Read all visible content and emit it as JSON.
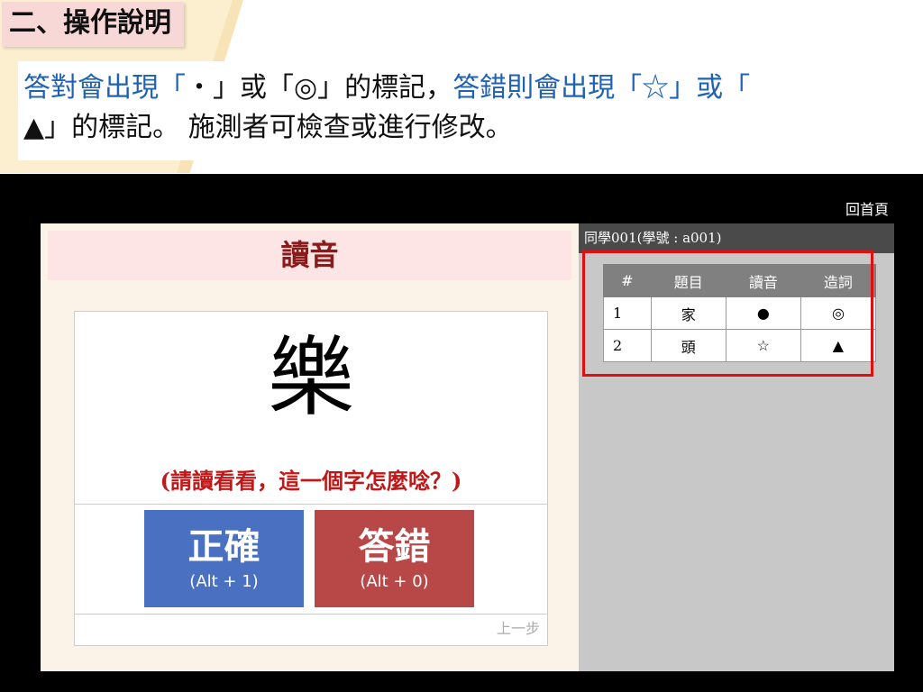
{
  "slide": {
    "section_title": "二、操作說明",
    "description": {
      "p1": "答對會出現「",
      "p2": "‧」或「◎」的標記，",
      "p3": "答錯則會出現「☆」或「",
      "p4": "▲」的標記。 施測者可檢查或進行修改。"
    }
  },
  "app": {
    "home_link": "回首頁",
    "panel_title": "讀音",
    "character": "樂",
    "prompt": "(請讀看看，這一個字怎麼唸？)",
    "correct_button": {
      "label": "正確",
      "shortcut": "(Alt + 1)"
    },
    "wrong_button": {
      "label": "答錯",
      "shortcut": "(Alt + 0)"
    },
    "prev_step": "上一步",
    "student_header": "同學001(學號 : a001)",
    "table": {
      "headers": [
        "#",
        "題目",
        "讀音",
        "造詞"
      ],
      "rows": [
        [
          "1",
          "家",
          "●",
          "◎"
        ],
        [
          "2",
          "頭",
          "☆",
          "▲"
        ]
      ]
    }
  },
  "colors": {
    "correct": "#4a70c2",
    "wrong": "#b84747",
    "highlight": "#e01010",
    "accent_text": "#1f62b4"
  }
}
